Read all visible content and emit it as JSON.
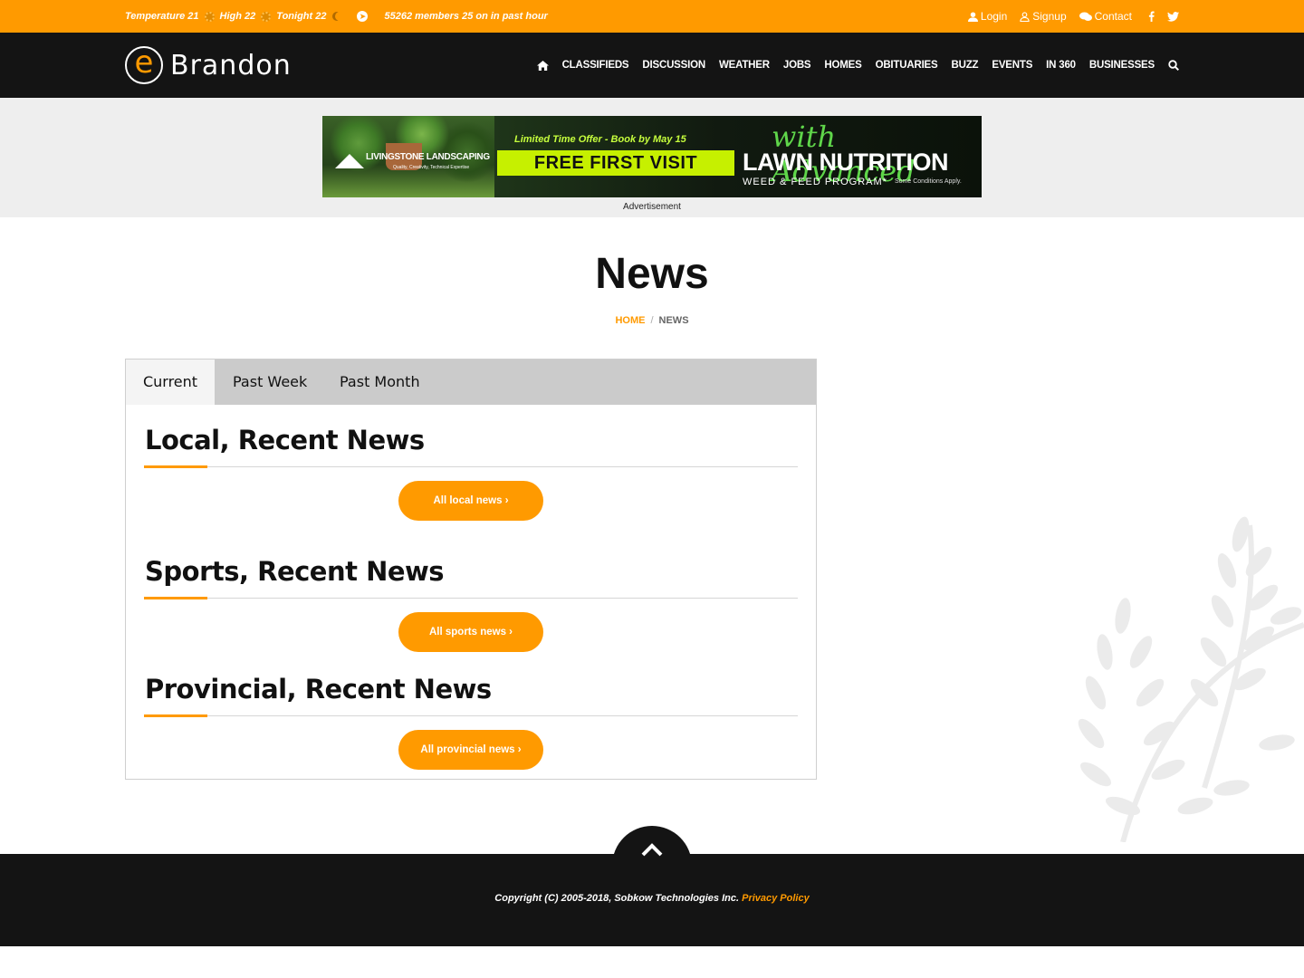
{
  "topbar": {
    "temperature": "Temperature 21",
    "high": "High 22",
    "tonight": "Tonight 22",
    "members": "55262 members 25 on in past hour",
    "login": "Login",
    "signup": "Signup",
    "contact": "Contact"
  },
  "logo": {
    "text": "Brandon",
    "mark": "e"
  },
  "menu": [
    "CLASSIFIEDS",
    "DISCUSSION",
    "WEATHER",
    "JOBS",
    "HOMES",
    "OBITUARIES",
    "BUZZ",
    "EVENTS",
    "IN 360",
    "BUSINESSES"
  ],
  "ad": {
    "brand": "LIVINGSTONE LANDSCAPING",
    "brand_tagline": "Quality, Creativity, Technical Expertise",
    "offer": "Limited Time Offer - Book by May 15",
    "headline": "FREE FIRST VISIT",
    "with": "with Advanced",
    "product": "LAWN NUTRITION",
    "program": "WEED & FEED PROGRAM*",
    "conditions": "Some Conditions Apply.",
    "label": "Advertisement"
  },
  "page": {
    "title": "News"
  },
  "breadcrumb": {
    "home": "HOME",
    "separator": "/",
    "current": "NEWS"
  },
  "tabs": [
    "Current",
    "Past Week",
    "Past Month"
  ],
  "sections": [
    {
      "heading": "Local, Recent News",
      "button": "All local news ›"
    },
    {
      "heading": "Sports, Recent News",
      "button": "All sports news ›"
    },
    {
      "heading": "Provincial, Recent News",
      "button": "All provincial news ›"
    }
  ],
  "footer": {
    "copyright": "Copyright (C) 2005-2018, Sobkow Technologies Inc.",
    "privacy": "Privacy Policy"
  },
  "colors": {
    "accent": "#ff9a00",
    "dark": "#141414",
    "tabbar": "#cbcbcb"
  }
}
